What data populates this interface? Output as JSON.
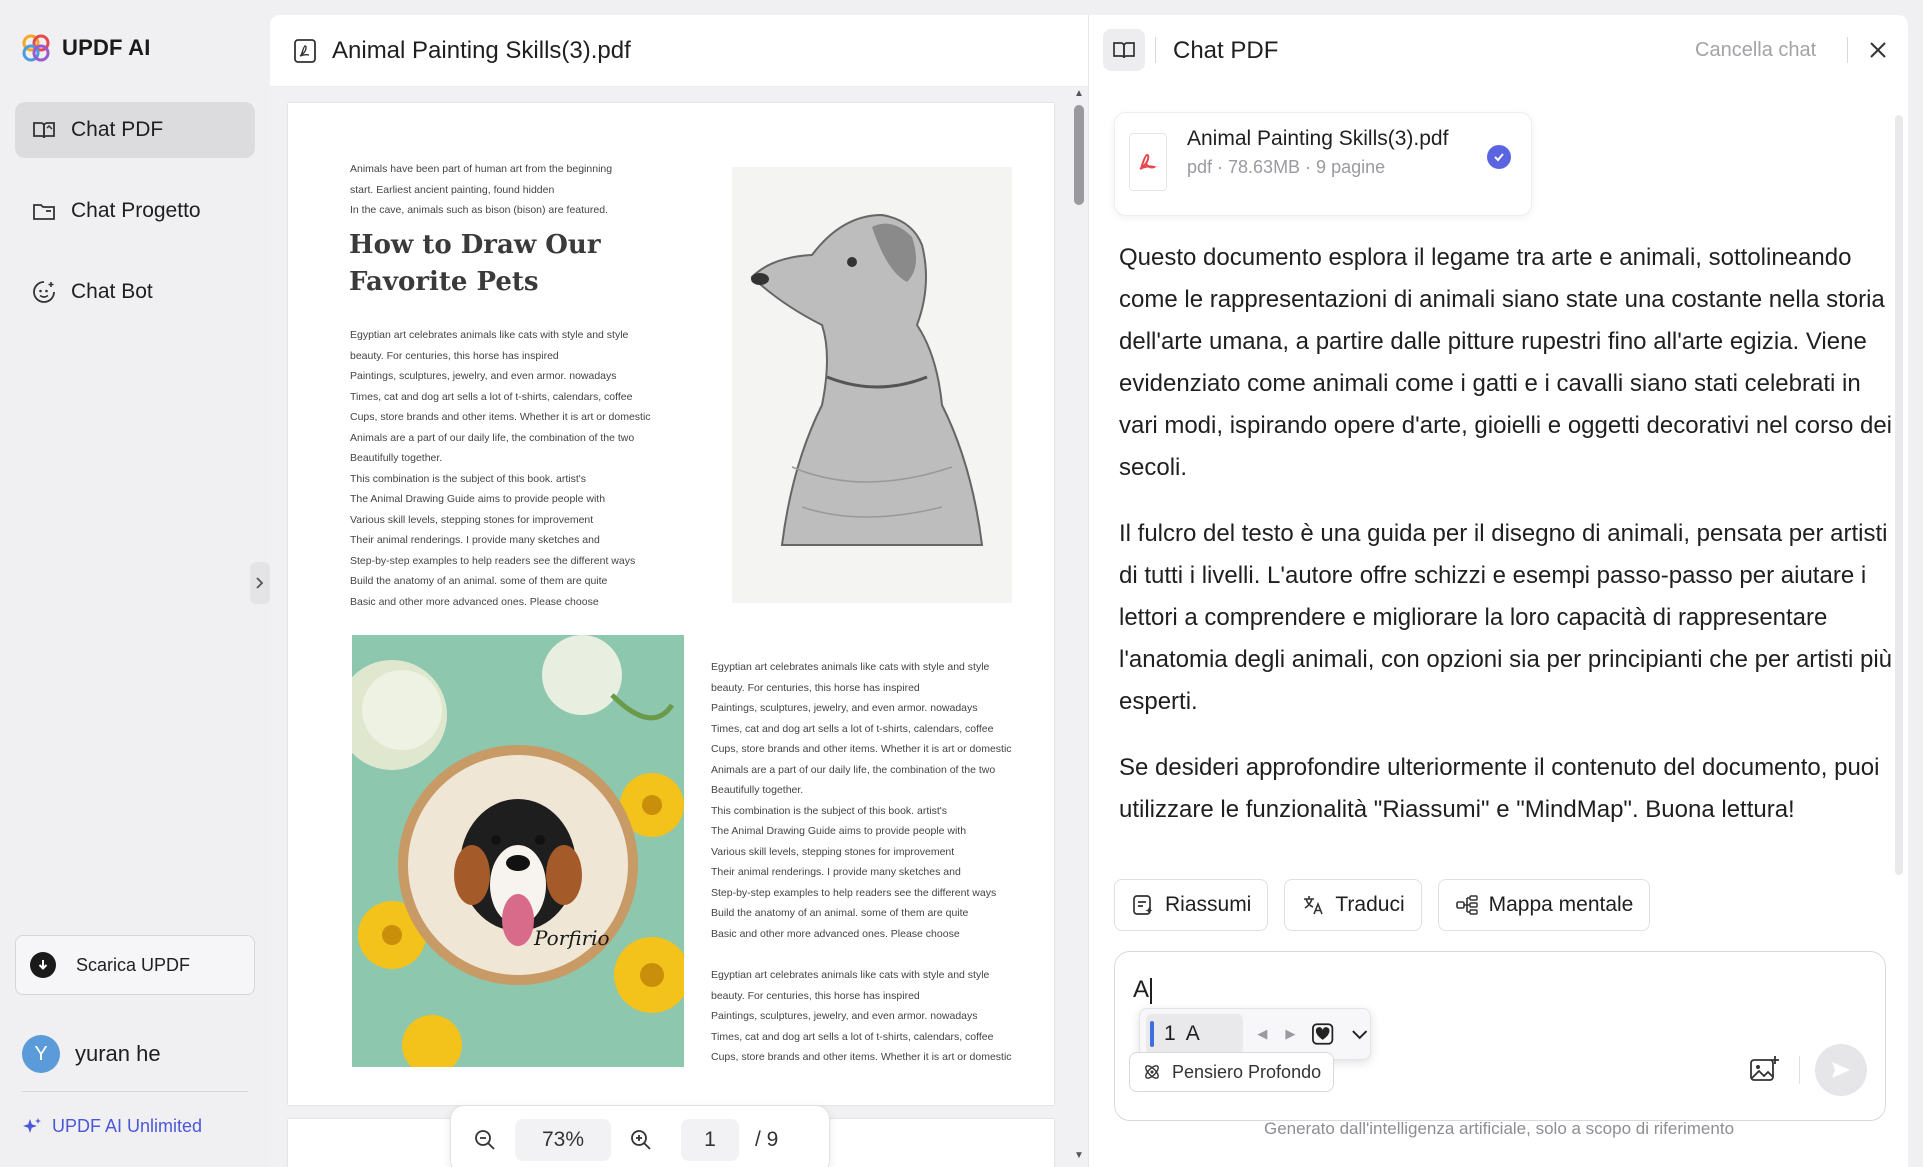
{
  "app": {
    "name": "UPDF AI"
  },
  "sidebar": {
    "items": [
      {
        "label": "Chat PDF",
        "icon": "book-open-icon",
        "active": true
      },
      {
        "label": "Chat Progetto",
        "icon": "folder-icon",
        "active": false
      },
      {
        "label": "Chat Bot",
        "icon": "bot-face-icon",
        "active": false
      }
    ],
    "download_label": "Scarica UPDF",
    "user": {
      "initial": "Y",
      "name": "yuran he"
    },
    "plan_label": "UPDF AI Unlimited"
  },
  "viewer": {
    "file_title": "Animal Painting Skills(3).pdf",
    "zoom": "73%",
    "current_page": "1",
    "total_pages": "/ 9",
    "page": {
      "intro": [
        "Animals have been part of human art from the beginning",
        "start. Earliest ancient painting, found hidden",
        "In the cave, animals such as bison (bison) are featured."
      ],
      "heading": [
        "How to Draw Our",
        "Favorite Pets"
      ],
      "body": [
        "Egyptian art celebrates animals like cats with style and style",
        "beauty. For centuries, this horse has inspired",
        "Paintings, sculptures, jewelry, and even armor. nowadays",
        "Times, cat and dog art sells a lot of t-shirts, calendars, coffee",
        "Cups, store brands and other items. Whether it is art or domestic",
        "Animals are a part of our daily life, the combination of the two",
        "Beautifully together.",
        "This combination is the subject of this book. artist's",
        "The Animal Drawing Guide aims to provide people with",
        "Various skill levels, stepping stones for improvement",
        "Their animal renderings. I provide many sketches and",
        "Step-by-step examples to help readers see the different ways",
        "Build the anatomy of an animal. some of them are quite",
        "Basic and other more advanced ones. Please choose"
      ],
      "body_tail": [
        "Egyptian art celebrates animals like cats with style and style",
        "beauty. For centuries, this horse has inspired",
        "Paintings, sculptures, jewelry, and even armor. nowadays",
        "Times, cat and dog art sells a lot of t-shirts, calendars, coffee",
        "Cups, store brands and other items. Whether it is art or domestic"
      ],
      "embroidery_text": "Porfirio"
    }
  },
  "chat": {
    "title": "Chat PDF",
    "clear_label": "Cancella chat",
    "file": {
      "name": "Animal Painting Skills(3).pdf",
      "meta": "pdf · 78.63MB · 9 pagine"
    },
    "answer": [
      "Questo documento esplora il legame tra arte e animali, sottolineando come le rappresentazioni di animali siano state una costante nella storia dell'arte umana, a partire dalle pitture rupestri fino all'arte egizia. Viene evidenziato come animali come i gatti e i cavalli siano stati celebrati in vari modi, ispirando opere d'arte, gioielli e oggetti decorativi nel corso dei secoli.",
      "Il fulcro del testo è una guida per il disegno di animali, pensata per artisti di tutti i livelli. L'autore offre schizzi e esempi passo-passo per aiutare i lettori a comprendere e migliorare la loro capacità di rappresentare l'anatomia degli animali, con opzioni sia per principianti che per artisti più esperti.",
      "Se desideri approfondire ulteriormente il contenuto del documento, puoi utilizzare le funzionalità \"Riassumi\" e \"MindMap\". Buona lettura!"
    ],
    "actions": [
      {
        "label": "Riassumi",
        "icon": "summarize-icon"
      },
      {
        "label": "Traduci",
        "icon": "translate-icon"
      },
      {
        "label": "Mappa mentale",
        "icon": "mindmap-icon"
      }
    ],
    "input_value": "A",
    "ime": {
      "candidate_index": "1",
      "candidate": "A"
    },
    "deep_think_label": "Pensiero Profondo",
    "disclaimer": "Generato dall'intelligenza artificiale, solo a scopo di riferimento"
  },
  "colors": {
    "accent": "#4b57d8",
    "check": "#5b64e0",
    "avatar": "#5b9bd9",
    "pdf_red": "#e5484d"
  }
}
